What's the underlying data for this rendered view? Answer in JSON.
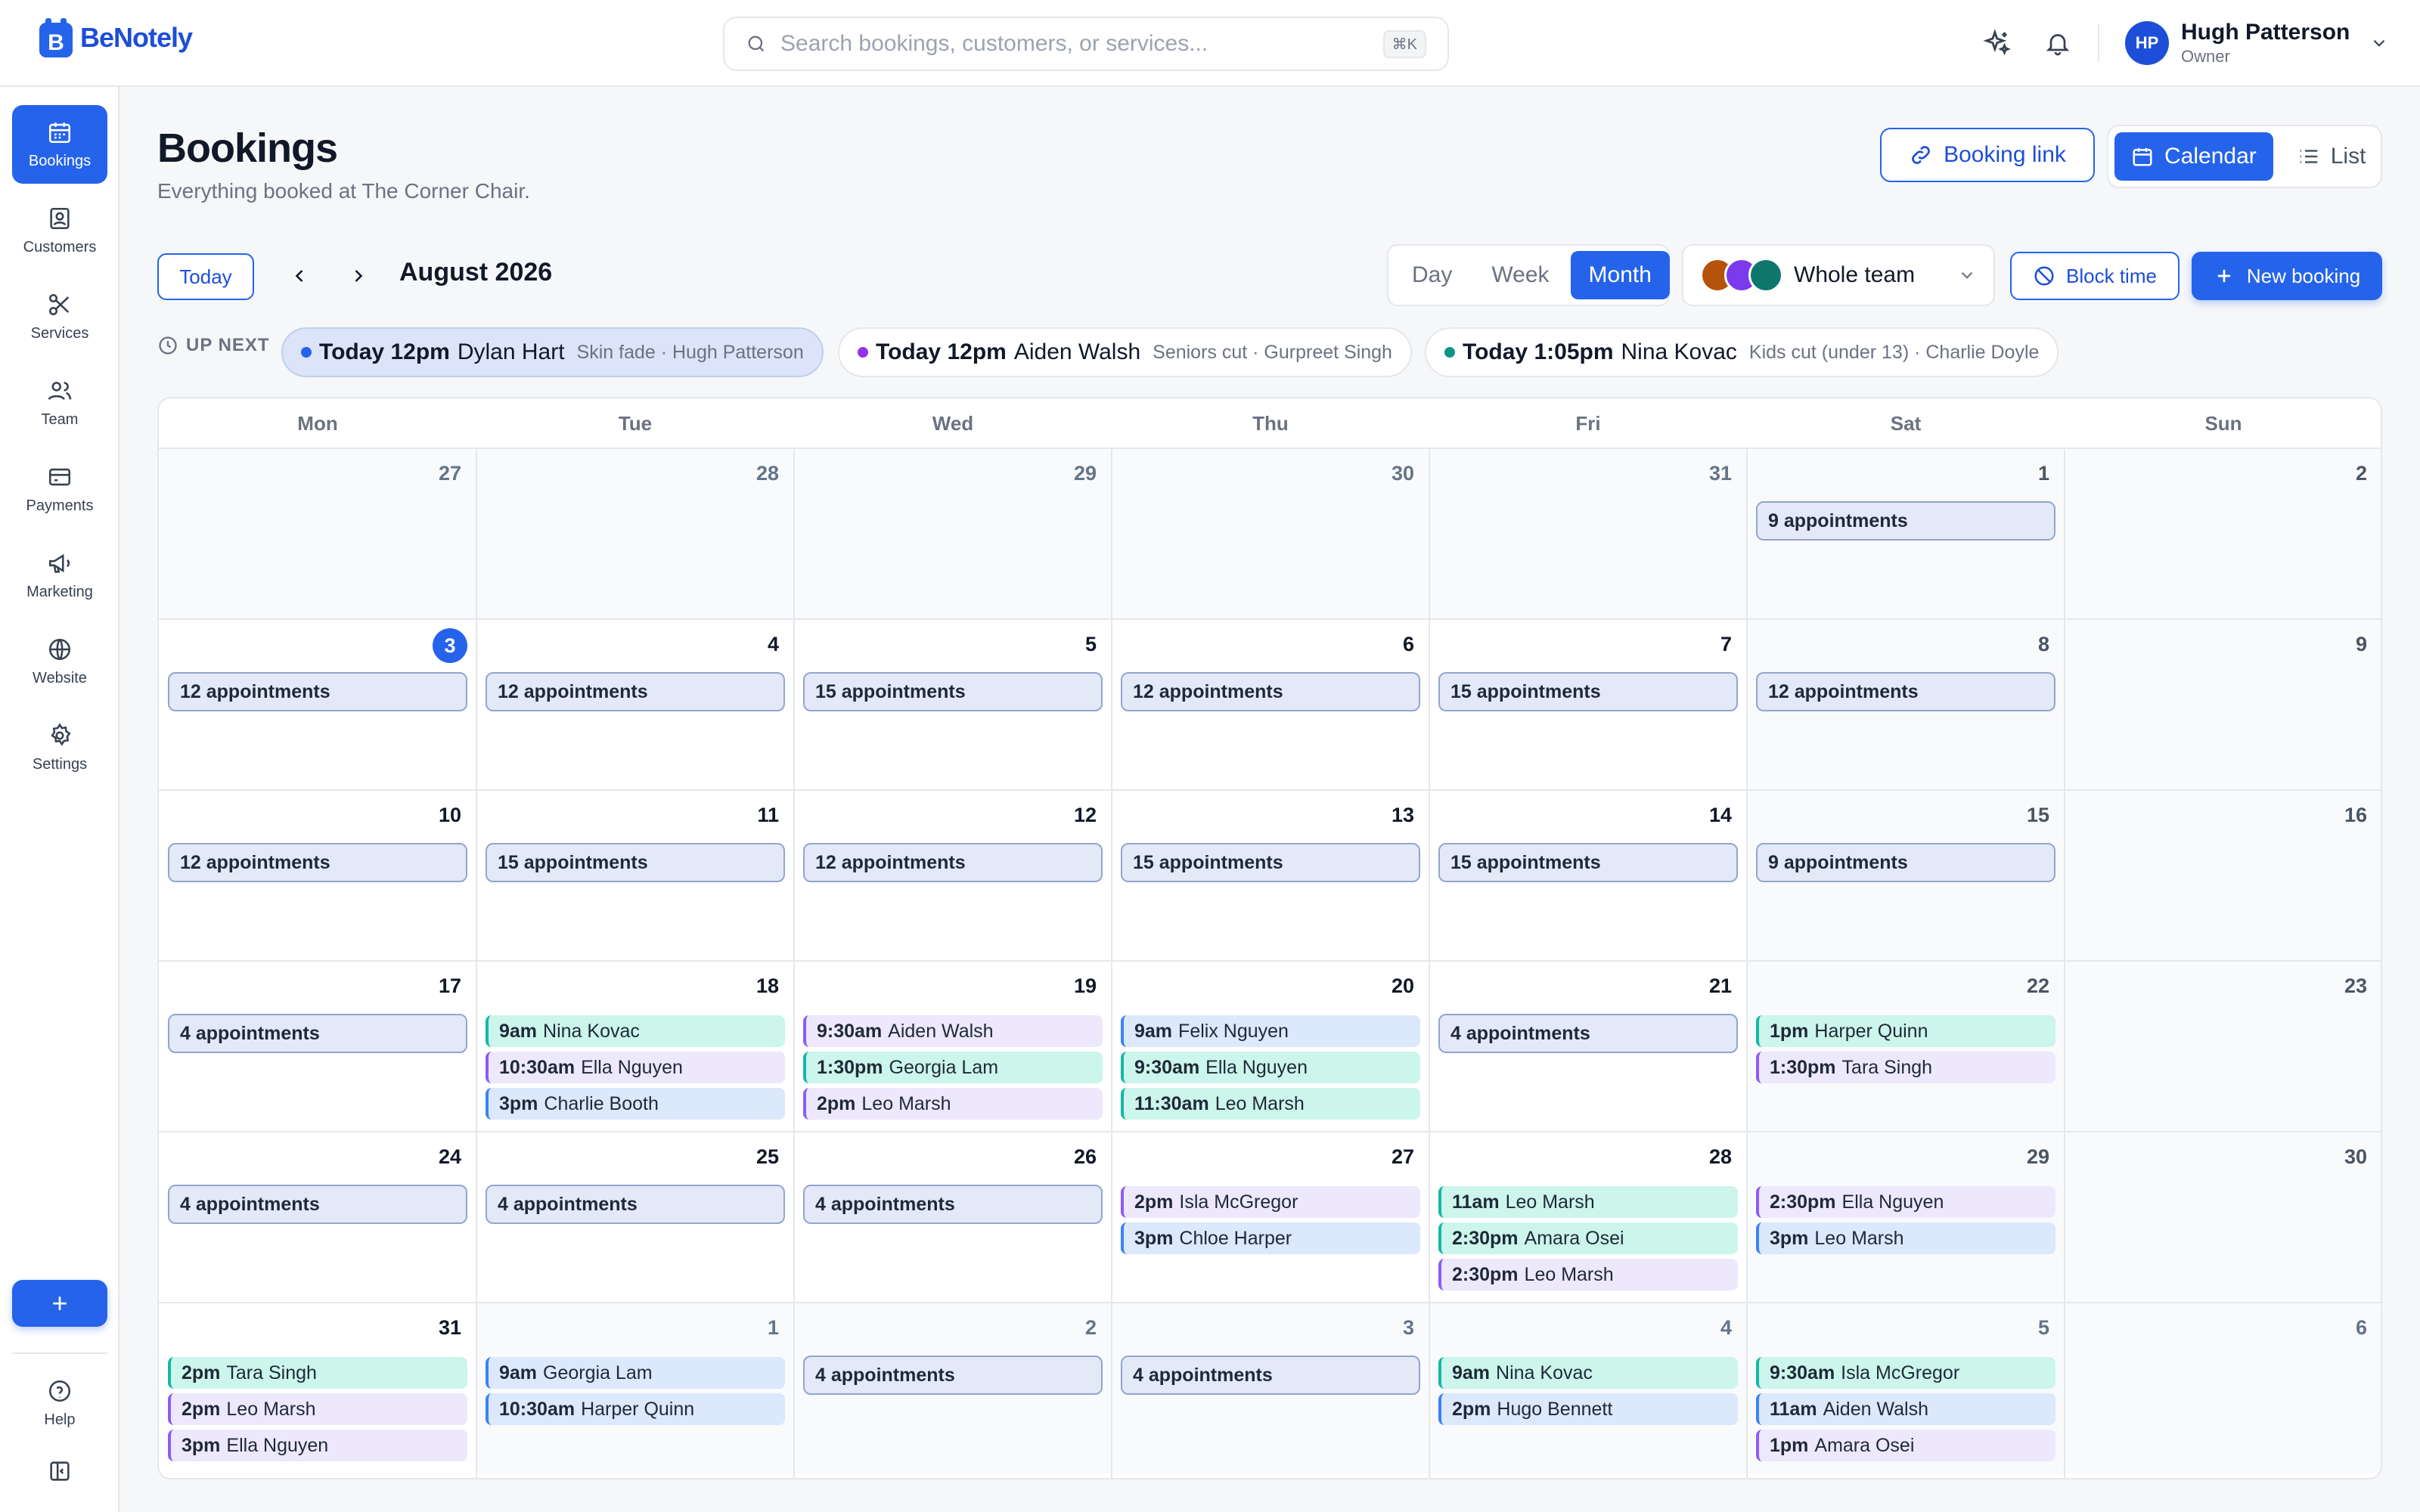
{
  "app": {
    "name": "BeNotely"
  },
  "search": {
    "placeholder": "Search bookings, customers, or services...",
    "shortcut": "⌘K"
  },
  "user": {
    "initials": "HP",
    "name": "Hugh Patterson",
    "role": "Owner"
  },
  "sidebar": {
    "items": [
      {
        "label": "Bookings",
        "icon": "calendar-icon",
        "active": true
      },
      {
        "label": "Customers",
        "icon": "customer-icon"
      },
      {
        "label": "Services",
        "icon": "scissors-icon"
      },
      {
        "label": "Team",
        "icon": "team-icon"
      },
      {
        "label": "Payments",
        "icon": "card-icon"
      },
      {
        "label": "Marketing",
        "icon": "megaphone-icon"
      },
      {
        "label": "Website",
        "icon": "globe-icon"
      },
      {
        "label": "Settings",
        "icon": "gear-icon"
      }
    ],
    "add_label": "+",
    "help_label": "Help"
  },
  "page": {
    "title": "Bookings",
    "subtitle": "Everything booked at The Corner Chair."
  },
  "actions": {
    "booking_link": "Booking link",
    "calendar": "Calendar",
    "list": "List",
    "today": "Today",
    "block_time": "Block time",
    "new_booking": "New booking"
  },
  "period": "August 2026",
  "view_modes": [
    "Day",
    "Week",
    "Month"
  ],
  "active_view": "Month",
  "team_filter": {
    "label": "Whole team",
    "avatar_colors": [
      "#b45309",
      "#7c3aed",
      "#0f766e"
    ]
  },
  "up_next": {
    "label": "UP NEXT",
    "items": [
      {
        "when": "Today 12pm",
        "who": "Dylan Hart",
        "what": "Skin fade · Hugh Patterson",
        "color": "#2563eb",
        "highlight": true
      },
      {
        "when": "Today 12pm",
        "who": "Aiden Walsh",
        "what": "Seniors cut · Gurpreet Singh",
        "color": "#9333ea"
      },
      {
        "when": "Today 1:05pm",
        "who": "Nina Kovac",
        "what": "Kids cut (under 13) · Charlie Doyle",
        "color": "#0d9488"
      }
    ]
  },
  "calendar": {
    "weekdays": [
      "Mon",
      "Tue",
      "Wed",
      "Thu",
      "Fri",
      "Sat",
      "Sun"
    ],
    "colors": {
      "teal": "#14b8a6",
      "purple": "#8b5cf6",
      "blue": "#3b82f6"
    },
    "weeks": [
      [
        {
          "day": "27",
          "outside": true
        },
        {
          "day": "28",
          "outside": true
        },
        {
          "day": "29",
          "outside": true
        },
        {
          "day": "30",
          "outside": true
        },
        {
          "day": "31",
          "outside": true
        },
        {
          "day": "1",
          "count": "9 appointments"
        },
        {
          "day": "2"
        }
      ],
      [
        {
          "day": "3",
          "today": true,
          "count": "12 appointments"
        },
        {
          "day": "4",
          "count": "12 appointments"
        },
        {
          "day": "5",
          "count": "15 appointments"
        },
        {
          "day": "6",
          "count": "12 appointments"
        },
        {
          "day": "7",
          "count": "15 appointments"
        },
        {
          "day": "8",
          "count": "12 appointments"
        },
        {
          "day": "9"
        }
      ],
      [
        {
          "day": "10",
          "count": "12 appointments"
        },
        {
          "day": "11",
          "count": "15 appointments"
        },
        {
          "day": "12",
          "count": "12 appointments"
        },
        {
          "day": "13",
          "count": "15 appointments"
        },
        {
          "day": "14",
          "count": "15 appointments"
        },
        {
          "day": "15",
          "count": "9 appointments"
        },
        {
          "day": "16"
        }
      ],
      [
        {
          "day": "17",
          "count": "4 appointments"
        },
        {
          "day": "18",
          "appts": [
            {
              "time": "9am",
              "name": "Nina Kovac",
              "color": "teal"
            },
            {
              "time": "10:30am",
              "name": "Ella Nguyen",
              "color": "purple"
            },
            {
              "time": "3pm",
              "name": "Charlie Booth",
              "color": "blue"
            }
          ]
        },
        {
          "day": "19",
          "appts": [
            {
              "time": "9:30am",
              "name": "Aiden Walsh",
              "color": "purple"
            },
            {
              "time": "1:30pm",
              "name": "Georgia Lam",
              "color": "teal"
            },
            {
              "time": "2pm",
              "name": "Leo Marsh",
              "color": "purple"
            }
          ]
        },
        {
          "day": "20",
          "appts": [
            {
              "time": "9am",
              "name": "Felix Nguyen",
              "color": "blue"
            },
            {
              "time": "9:30am",
              "name": "Ella Nguyen",
              "color": "teal"
            },
            {
              "time": "11:30am",
              "name": "Leo Marsh",
              "color": "teal"
            }
          ]
        },
        {
          "day": "21",
          "count": "4 appointments"
        },
        {
          "day": "22",
          "appts": [
            {
              "time": "1pm",
              "name": "Harper Quinn",
              "color": "teal"
            },
            {
              "time": "1:30pm",
              "name": "Tara Singh",
              "color": "purple"
            }
          ]
        },
        {
          "day": "23"
        }
      ],
      [
        {
          "day": "24",
          "count": "4 appointments"
        },
        {
          "day": "25",
          "count": "4 appointments"
        },
        {
          "day": "26",
          "count": "4 appointments"
        },
        {
          "day": "27",
          "appts": [
            {
              "time": "2pm",
              "name": "Isla McGregor",
              "color": "purple"
            },
            {
              "time": "3pm",
              "name": "Chloe Harper",
              "color": "blue"
            }
          ]
        },
        {
          "day": "28",
          "appts": [
            {
              "time": "11am",
              "name": "Leo Marsh",
              "color": "teal"
            },
            {
              "time": "2:30pm",
              "name": "Amara Osei",
              "color": "teal"
            },
            {
              "time": "2:30pm",
              "name": "Leo Marsh",
              "color": "purple"
            }
          ]
        },
        {
          "day": "29",
          "appts": [
            {
              "time": "2:30pm",
              "name": "Ella Nguyen",
              "color": "purple"
            },
            {
              "time": "3pm",
              "name": "Leo Marsh",
              "color": "blue"
            }
          ]
        },
        {
          "day": "30"
        }
      ],
      [
        {
          "day": "31",
          "appts": [
            {
              "time": "2pm",
              "name": "Tara Singh",
              "color": "teal"
            },
            {
              "time": "2pm",
              "name": "Leo Marsh",
              "color": "purple"
            },
            {
              "time": "3pm",
              "name": "Ella Nguyen",
              "color": "purple"
            }
          ]
        },
        {
          "day": "1",
          "outside": true,
          "appts": [
            {
              "time": "9am",
              "name": "Georgia Lam",
              "color": "blue"
            },
            {
              "time": "10:30am",
              "name": "Harper Quinn",
              "color": "blue"
            }
          ]
        },
        {
          "day": "2",
          "outside": true,
          "count": "4 appointments"
        },
        {
          "day": "3",
          "outside": true,
          "count": "4 appointments"
        },
        {
          "day": "4",
          "outside": true,
          "appts": [
            {
              "time": "9am",
              "name": "Nina Kovac",
              "color": "teal"
            },
            {
              "time": "2pm",
              "name": "Hugo Bennett",
              "color": "blue"
            }
          ]
        },
        {
          "day": "5",
          "outside": true,
          "appts": [
            {
              "time": "9:30am",
              "name": "Isla McGregor",
              "color": "teal"
            },
            {
              "time": "11am",
              "name": "Aiden Walsh",
              "color": "blue"
            },
            {
              "time": "1pm",
              "name": "Amara Osei",
              "color": "purple"
            }
          ]
        },
        {
          "day": "6",
          "outside": true
        }
      ]
    ]
  }
}
